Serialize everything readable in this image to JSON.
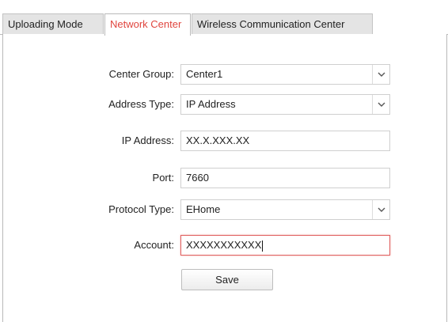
{
  "tabs": [
    {
      "label": "Uploading Mode",
      "active": false
    },
    {
      "label": "Network Center",
      "active": true
    },
    {
      "label": "Wireless Communication Center",
      "active": false
    }
  ],
  "form": {
    "center_group": {
      "label": "Center Group:",
      "value": "Center1"
    },
    "address_type": {
      "label": "Address Type:",
      "value": "IP Address"
    },
    "ip_address": {
      "label": "IP Address:",
      "value": "XX.X.XXX.XX"
    },
    "port": {
      "label": "Port:",
      "value": "7660"
    },
    "protocol_type": {
      "label": "Protocol Type:",
      "value": "EHome"
    },
    "account": {
      "label": "Account:",
      "value": "XXXXXXXXXXX"
    }
  },
  "save_label": "Save",
  "colors": {
    "active_tab_text": "#e0463f",
    "focus_border": "#e06060"
  },
  "icons": {
    "dropdown": "chevron-down-icon"
  }
}
